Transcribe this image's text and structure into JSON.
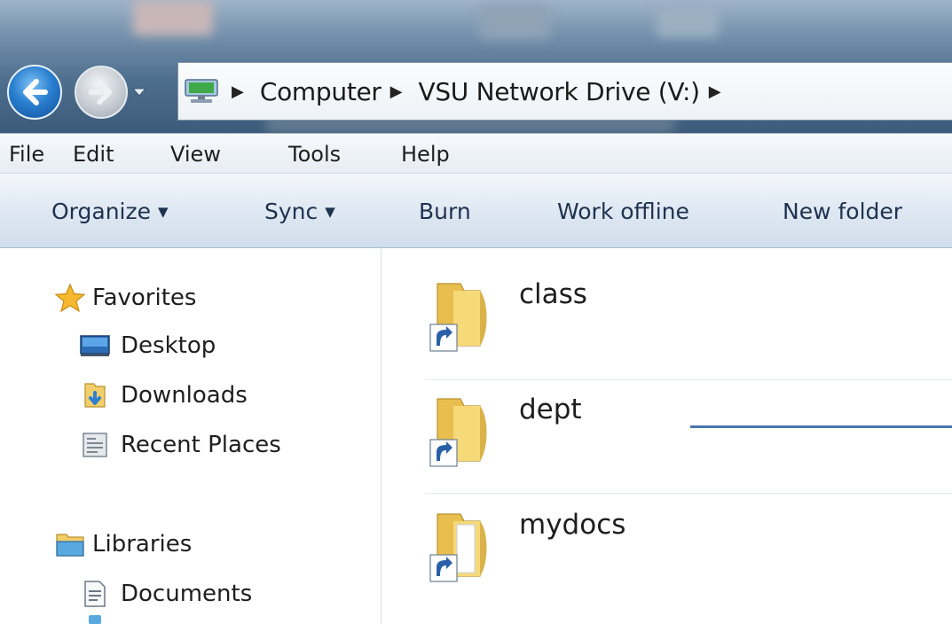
{
  "address_bar": {
    "breadcrumbs": [
      "Computer",
      "VSU Network Drive (V:)"
    ],
    "root_icon": "computer-icon"
  },
  "menu": {
    "items": [
      "File",
      "Edit",
      "View",
      "Tools",
      "Help"
    ]
  },
  "toolbar": {
    "organize": "Organize",
    "sync": "Sync",
    "burn": "Burn",
    "work_offline": "Work offline",
    "new_folder": "New folder"
  },
  "navigation": {
    "favorites": {
      "label": "Favorites",
      "icon": "star-icon",
      "items": [
        {
          "label": "Desktop",
          "icon": "desktop-icon"
        },
        {
          "label": "Downloads",
          "icon": "downloads-icon"
        },
        {
          "label": "Recent Places",
          "icon": "recent-places-icon"
        }
      ]
    },
    "libraries": {
      "label": "Libraries",
      "icon": "libraries-icon",
      "items": [
        {
          "label": "Documents",
          "icon": "documents-icon"
        }
      ]
    }
  },
  "files": [
    {
      "name": "class",
      "icon": "folder-shortcut-icon"
    },
    {
      "name": "dept",
      "icon": "folder-shortcut-icon"
    },
    {
      "name": "mydocs",
      "icon": "folder-shortcut-icon"
    }
  ],
  "colors": {
    "back_button": "#1f6fc5",
    "annotation_line": "#4a76ad",
    "command_text": "#1e3250",
    "folder_yellow": "#f2cf6a"
  }
}
